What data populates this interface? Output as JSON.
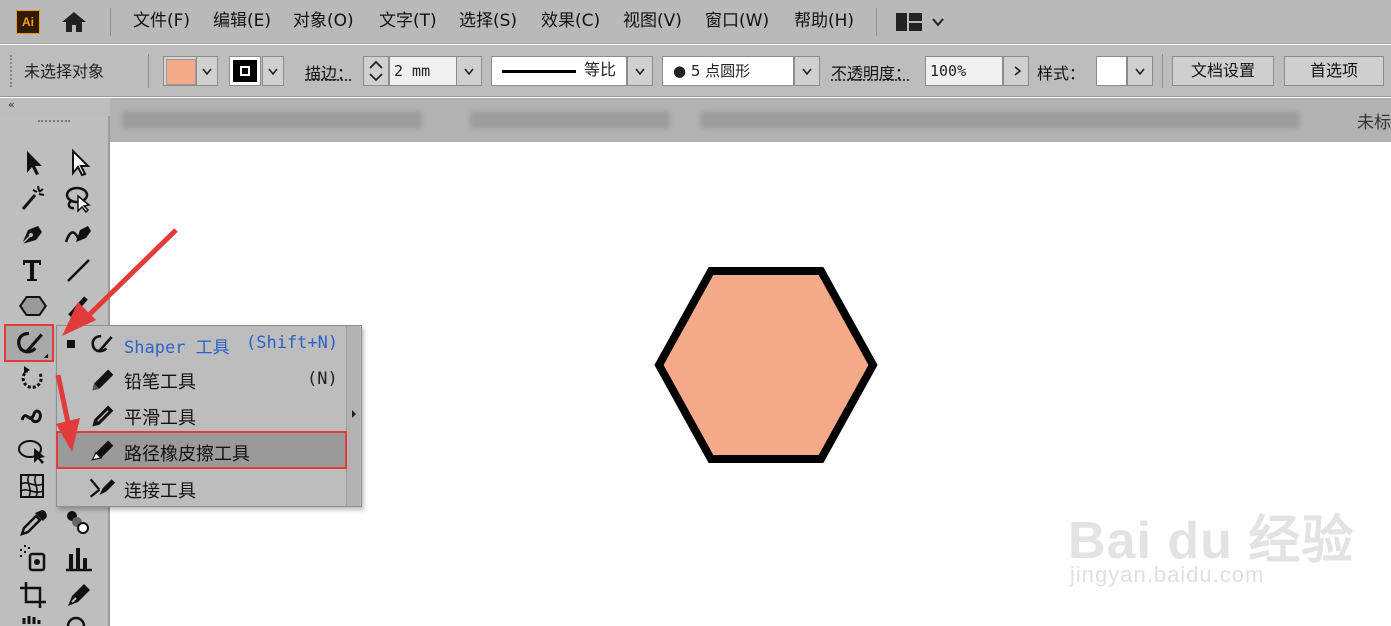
{
  "app": {
    "logo_text": "Ai",
    "accent": "#ff9a00"
  },
  "menubar": {
    "items": [
      "文件(F)",
      "编辑(E)",
      "对象(O)",
      "文字(T)",
      "选择(S)",
      "效果(C)",
      "视图(V)",
      "窗口(W)",
      "帮助(H)"
    ]
  },
  "controlbar": {
    "selection_status": "未选择对象",
    "fill_color": "#f4a988",
    "stroke_label": "描边：",
    "stroke_value": "2 mm",
    "stroke_profile": "等比",
    "brush": "●  5 点圆形",
    "opacity_label": "不透明度：",
    "opacity_value": "100%",
    "style_label": "样式：",
    "doc_setup": "文档设置",
    "preferences": "首选项"
  },
  "tabs": {
    "trailing_text": "未标"
  },
  "flyout": {
    "items": [
      {
        "label": "Shaper 工具",
        "shortcut": "(Shift+N)",
        "active": true,
        "icon": "shaper-icon"
      },
      {
        "label": "铅笔工具",
        "shortcut": "(N)",
        "icon": "pencil-icon"
      },
      {
        "label": "平滑工具",
        "shortcut": "",
        "icon": "smooth-icon"
      },
      {
        "label": "路径橡皮擦工具",
        "shortcut": "",
        "highlighted": true,
        "icon": "path-eraser-icon"
      },
      {
        "label": "连接工具",
        "shortcut": "",
        "icon": "join-icon"
      }
    ],
    "active_color": "#2a62c9"
  },
  "canvas": {
    "shape": {
      "type": "hexagon",
      "fill": "#f4a988",
      "stroke": "#000000"
    }
  },
  "annotations": {
    "color": "#e23b3b"
  },
  "watermark": {
    "main": "Bai du 经验",
    "sub": "jingyan.baidu.com"
  }
}
